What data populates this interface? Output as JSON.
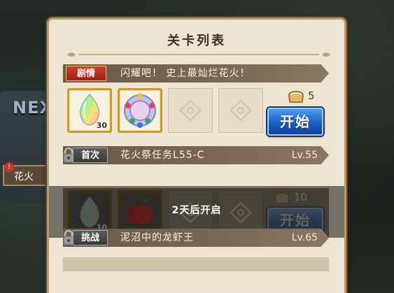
{
  "background": {
    "next_label": "NEX",
    "left_banner": "花火",
    "left_badge": "!"
  },
  "panel": {
    "title": "关卡列表"
  },
  "stage_1": {
    "tag": "剧情",
    "name": "闪耀吧！ 史上最灿烂花火！",
    "rewards": [
      {
        "icon": "rainbow-crystal-icon",
        "count": "30"
      },
      {
        "icon": "wreath-medal-icon",
        "count": ""
      }
    ],
    "cost_icon": "bread-stamina-icon",
    "cost": "5",
    "start_label": "开始"
  },
  "stage_2": {
    "tag": "首次",
    "name": "花火祭任务L55-C",
    "level": "Lv.55",
    "rewards": [
      {
        "icon": "rainbow-crystal-icon",
        "count": "10"
      },
      {
        "icon": "apple-icon",
        "count": ""
      }
    ],
    "cost": "10",
    "start_label": "开始",
    "lock_message": "2天后开启"
  },
  "stage_3": {
    "tag": "挑战",
    "name": "泥沼中的龙虾王",
    "level": "Lv.65"
  },
  "colors": {
    "tag_red": "#c0392b",
    "start_blue": "#1c5fc6",
    "panel_bg": "#eee4d2",
    "frame_gold": "#c99a2e"
  }
}
